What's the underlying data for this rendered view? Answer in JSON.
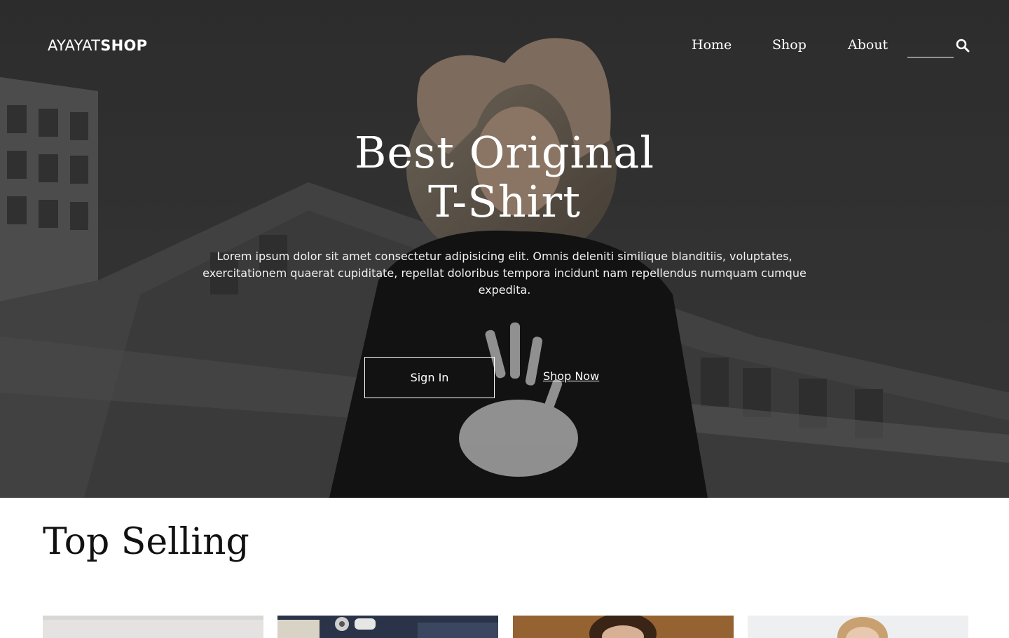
{
  "brand": {
    "thin": "AYAYAT",
    "bold": "SHOP"
  },
  "nav": {
    "items": [
      {
        "label": "Home"
      },
      {
        "label": "Shop"
      },
      {
        "label": "About"
      }
    ],
    "search_placeholder": "",
    "search_icon": "search-icon"
  },
  "hero": {
    "title_line1": "Best Original",
    "title_line2": "T-Shirt",
    "description": "Lorem ipsum dolor sit amet consectetur adipisicing elit. Omnis deleniti similique blanditiis, voluptates, exercitationem quaerat cupiditate, repellat doloribus tempora incidunt nam repellendus numquam cumque expedita.",
    "signin_label": "Sign In",
    "shopnow_label": "Shop Now"
  },
  "top_selling": {
    "title": "Top Selling",
    "products": [
      {
        "image": "product-image-1"
      },
      {
        "image": "product-image-2"
      },
      {
        "image": "product-image-3"
      },
      {
        "image": "product-image-4"
      }
    ]
  },
  "colors": {
    "hero_bg": "#2e2e2e",
    "text_light": "#ffffff",
    "heading_dark": "#111111"
  }
}
